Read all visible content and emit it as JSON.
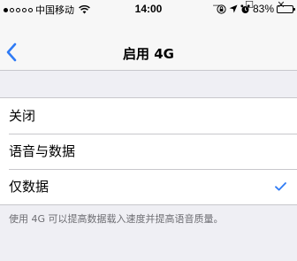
{
  "status_bar": {
    "carrier": "中国移动",
    "time": "14:00",
    "battery": "83%",
    "battery_level": 0.83
  },
  "window_controls": {
    "minimize": "—",
    "maximize": "☐",
    "close": "✕"
  },
  "nav": {
    "title": "启用 4G"
  },
  "options": [
    {
      "label": "关闭",
      "selected": false
    },
    {
      "label": "语音与数据",
      "selected": false
    },
    {
      "label": "仅数据",
      "selected": true
    }
  ],
  "footnote": "使用 4G 可以提高数据载入速度并提高语音质量。",
  "colors": {
    "accent": "#2f7bf5",
    "background": "#efeff4"
  }
}
